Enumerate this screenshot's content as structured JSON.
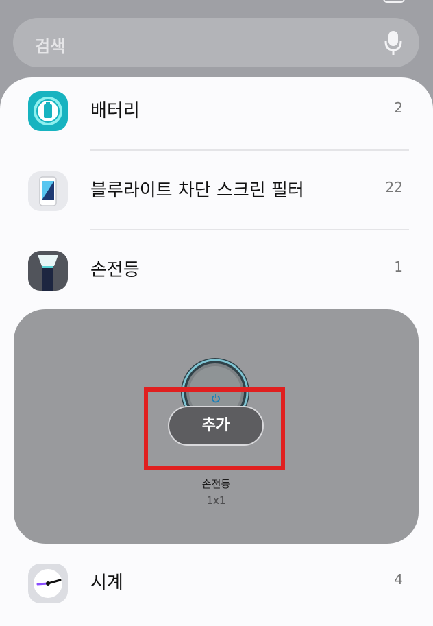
{
  "search": {
    "placeholder": "검색",
    "mic_icon": "microphone-icon"
  },
  "list": {
    "items": [
      {
        "name": "배터리",
        "count": "2",
        "icon": "battery-app-icon",
        "accent": "#1fc2c9"
      },
      {
        "name": "블루라이트 차단 스크린 필터",
        "count": "22",
        "icon": "bluelight-filter-app-icon",
        "accent": "#2aa3e0"
      },
      {
        "name": "손전등",
        "count": "1",
        "icon": "flashlight-app-icon",
        "accent": "#273049"
      },
      {
        "name": "시계",
        "count": "4",
        "icon": "clock-app-icon",
        "accent": "#8a4dff"
      }
    ]
  },
  "popup": {
    "add_label": "추가",
    "widget_name": "손전등",
    "widget_size": "1x1",
    "preview_icon": "power-icon",
    "highlight_color": "#e01f1f"
  }
}
